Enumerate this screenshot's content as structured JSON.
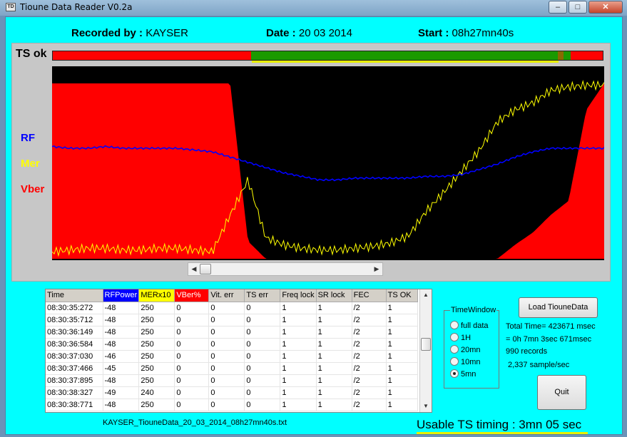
{
  "window": {
    "title": "Tioune Data Reader V0.2a",
    "app_icon_text": "TD",
    "controls": [
      "–",
      "□",
      "✕"
    ]
  },
  "header": {
    "recorded_label": "Recorded by :",
    "recorded_value": "KAYSER",
    "date_label": "Date :",
    "date_value": "20 03 2014",
    "start_label": "Start :",
    "start_value": "08h27mn40s"
  },
  "chart": {
    "ts_ok_label": "TS ok",
    "rf_label": "RF",
    "mer_label": "Mer",
    "vber_label": "Vber",
    "colors": {
      "rf": "#0000ff",
      "mer": "#ffff00",
      "vber": "#ff0000",
      "ts_ok": "#1a9a00",
      "background": "#000000"
    }
  },
  "chart_data": {
    "type": "line",
    "x_label": "",
    "series": [
      {
        "name": "RF",
        "color": "#0000ff",
        "values": [
          0.64,
          0.63,
          0.63,
          0.64,
          0.63,
          0.63,
          0.63,
          0.63,
          0.62,
          0.61,
          0.58,
          0.55,
          0.52,
          0.49,
          0.47,
          0.45,
          0.45,
          0.46,
          0.46,
          0.46,
          0.46,
          0.47,
          0.47,
          0.48,
          0.51,
          0.54,
          0.58,
          0.61,
          0.63,
          0.63,
          0.63,
          0.63
        ]
      },
      {
        "name": "Mer",
        "color": "#ffff00",
        "values": [
          0.04,
          0.05,
          0.06,
          0.06,
          0.05,
          0.05,
          0.06,
          0.06,
          0.05,
          0.04,
          0.25,
          0.45,
          0.12,
          0.08,
          0.06,
          0.05,
          0.05,
          0.06,
          0.07,
          0.09,
          0.13,
          0.27,
          0.38,
          0.5,
          0.62,
          0.78,
          0.85,
          0.89,
          0.96,
          0.98,
          0.99,
          0.99
        ]
      },
      {
        "name": "Vber",
        "color": "#ff0000",
        "values": [
          1,
          1,
          1,
          1,
          1,
          1,
          1,
          1,
          1,
          1,
          1,
          0.1,
          0,
          0,
          0,
          0,
          0,
          0,
          0,
          0,
          0,
          0,
          0,
          0,
          0,
          0,
          0.08,
          0.15,
          0.25,
          0.33,
          0.85,
          1
        ]
      }
    ]
  },
  "table": {
    "headers": [
      {
        "label": "Time",
        "color": "#d4d0c8",
        "text_color": "#000000"
      },
      {
        "label": "RFPower",
        "color": "#0000ff",
        "text_color": "#ffffff"
      },
      {
        "label": "MERx10",
        "color": "#ffff00",
        "text_color": "#000000"
      },
      {
        "label": "VBer%",
        "color": "#ff0000",
        "text_color": "#ffffff"
      },
      {
        "label": "Vit. err",
        "color": "#d4d0c8",
        "text_color": "#000000"
      },
      {
        "label": "TS err",
        "color": "#d4d0c8",
        "text_color": "#000000"
      },
      {
        "label": "Freq lock",
        "color": "#d4d0c8",
        "text_color": "#000000"
      },
      {
        "label": "SR lock",
        "color": "#d4d0c8",
        "text_color": "#000000"
      },
      {
        "label": "FEC",
        "color": "#d4d0c8",
        "text_color": "#000000"
      },
      {
        "label": "TS OK",
        "color": "#d4d0c8",
        "text_color": "#000000"
      }
    ],
    "rows": [
      [
        "08:30:35:272",
        "-48",
        "250",
        "0",
        "0",
        "0",
        "1",
        "1",
        "/2",
        "1"
      ],
      [
        "08:30:35:712",
        "-48",
        "250",
        "0",
        "0",
        "0",
        "1",
        "1",
        "/2",
        "1"
      ],
      [
        "08:30:36:149",
        "-48",
        "250",
        "0",
        "0",
        "0",
        "1",
        "1",
        "/2",
        "1"
      ],
      [
        "08:30:36:584",
        "-48",
        "250",
        "0",
        "0",
        "0",
        "1",
        "1",
        "/2",
        "1"
      ],
      [
        "08:30:37:030",
        "-46",
        "250",
        "0",
        "0",
        "0",
        "1",
        "1",
        "/2",
        "1"
      ],
      [
        "08:30:37:466",
        "-45",
        "250",
        "0",
        "0",
        "0",
        "1",
        "1",
        "/2",
        "1"
      ],
      [
        "08:30:37:895",
        "-48",
        "250",
        "0",
        "0",
        "0",
        "1",
        "1",
        "/2",
        "1"
      ],
      [
        "08:30:38:327",
        "-49",
        "240",
        "0",
        "0",
        "0",
        "1",
        "1",
        "/2",
        "1"
      ],
      [
        "08:30:38:771",
        "-48",
        "250",
        "0",
        "0",
        "0",
        "1",
        "1",
        "/2",
        "1"
      ]
    ]
  },
  "filename": "KAYSER_TiouneData_20_03_2014_08h27mn40s.txt",
  "time_window": {
    "title": "TimeWindow",
    "options": [
      "full data",
      "1H",
      "20mn",
      "10mn",
      "5mn"
    ],
    "selected": "5mn"
  },
  "buttons": {
    "load": "Load TiouneData",
    "quit": "Quit"
  },
  "stats": {
    "total_time": "Total Time= 423671 msec",
    "duration": "= 0h 7mn 3sec 671msec",
    "records": "990 records",
    "sample_rate": "2,337 sample/sec"
  },
  "usable_ts": "Usable TS timing : 3mn 05 sec"
}
